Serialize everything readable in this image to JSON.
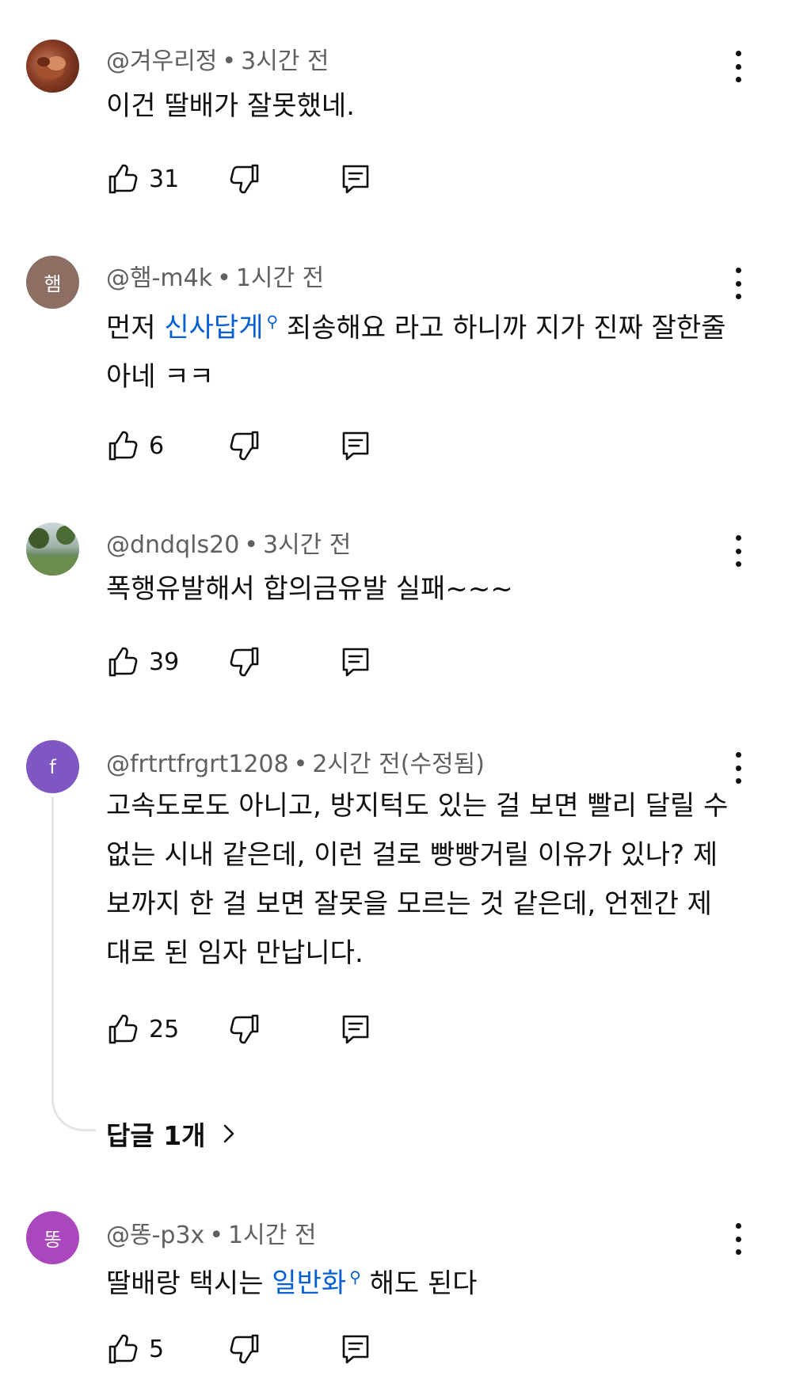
{
  "colors": {
    "link": "#065fd4",
    "meta": "#606060",
    "text": "#0f0f0f"
  },
  "comments": [
    {
      "author": "@겨우리정",
      "time": "3시간 전",
      "text": "이건 딸배가 잘못했네.",
      "likes": "31",
      "avatar": {
        "kind": "photo"
      }
    },
    {
      "author": "@햄-m4k",
      "time": "1시간 전",
      "text_before": "먼저 ",
      "link": "신사답게",
      "text_after": " 죄송해요 라고 하니까 지가 진짜 잘한줄아네 ㅋㅋ",
      "likes": "6",
      "avatar": {
        "letter": "햄",
        "color": "#8d6e63"
      }
    },
    {
      "author": "@dndqls20",
      "time": "3시간 전",
      "text": "폭행유발해서 합의금유발 실패~~~",
      "likes": "39",
      "avatar": {
        "kind": "photo"
      }
    },
    {
      "author": "@frtrtfrgrt1208",
      "time": "2시간 전(수정됨)",
      "text": "고속도로도 아니고, 방지턱도 있는 걸 보면 빨리 달릴 수 없는 시내 같은데, 이런 걸로 빵빵거릴 이유가 있나? 제보까지 한 걸 보면 잘못을 모르는 것 같은데, 언젠간 제대로 된 임자 만납니다.",
      "likes": "25",
      "avatar": {
        "letter": "f",
        "color": "#7e57c2"
      },
      "replies_label": "답글 1개"
    },
    {
      "author": "@똥-p3x",
      "time": "1시간 전",
      "text_before": "딸배랑 택시는 ",
      "link": "일반화",
      "text_after": " 해도 된다",
      "likes": "5",
      "avatar": {
        "letter": "똥",
        "color": "#ab47bc"
      }
    }
  ]
}
